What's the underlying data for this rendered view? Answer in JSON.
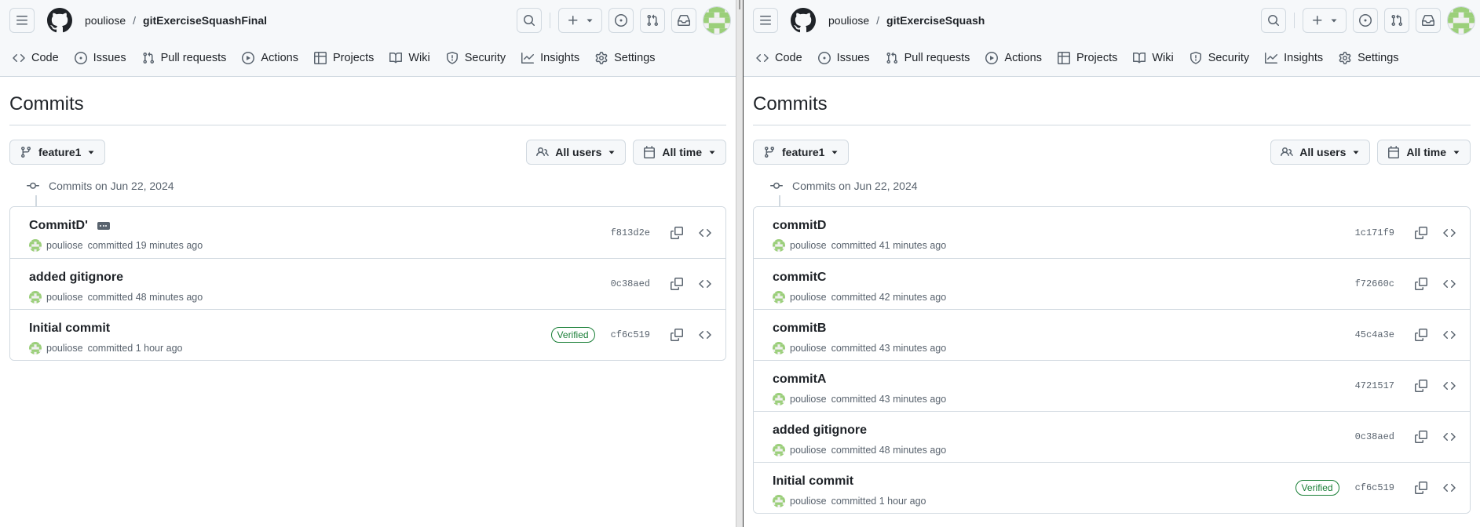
{
  "colors": {
    "accent_green": "#1a7f37",
    "muted": "#59636e",
    "border": "#d1d9e0",
    "header_bg": "#f6f8fa"
  },
  "panes": [
    {
      "owner": "pouliose",
      "separator": "/",
      "repo": "gitExerciseSquashFinal",
      "nav": [
        "Code",
        "Issues",
        "Pull requests",
        "Actions",
        "Projects",
        "Wiki",
        "Security",
        "Insights",
        "Settings"
      ],
      "page_title": "Commits",
      "branch": "feature1",
      "users_filter": "All users",
      "time_filter": "All time",
      "day_label": "Commits on Jun 22, 2024",
      "commits": [
        {
          "message": "CommitD'",
          "author": "pouliose",
          "meta": "committed 19 minutes ago",
          "sha": "f813d2e",
          "verified": "",
          "has_ellipsis": true
        },
        {
          "message": "added gitignore",
          "author": "pouliose",
          "meta": "committed 48 minutes ago",
          "sha": "0c38aed",
          "verified": "",
          "has_ellipsis": false
        },
        {
          "message": "Initial commit",
          "author": "pouliose",
          "meta": "committed 1 hour ago",
          "sha": "cf6c519",
          "verified": "Verified",
          "has_ellipsis": false
        }
      ]
    },
    {
      "owner": "pouliose",
      "separator": "/",
      "repo": "gitExerciseSquash",
      "nav": [
        "Code",
        "Issues",
        "Pull requests",
        "Actions",
        "Projects",
        "Wiki",
        "Security",
        "Insights",
        "Settings"
      ],
      "page_title": "Commits",
      "branch": "feature1",
      "users_filter": "All users",
      "time_filter": "All time",
      "day_label": "Commits on Jun 22, 2024",
      "commits": [
        {
          "message": "commitD",
          "author": "pouliose",
          "meta": "committed 41 minutes ago",
          "sha": "1c171f9",
          "verified": "",
          "has_ellipsis": false
        },
        {
          "message": "commitC",
          "author": "pouliose",
          "meta": "committed 42 minutes ago",
          "sha": "f72660c",
          "verified": "",
          "has_ellipsis": false
        },
        {
          "message": "commitB",
          "author": "pouliose",
          "meta": "committed 43 minutes ago",
          "sha": "45c4a3e",
          "verified": "",
          "has_ellipsis": false
        },
        {
          "message": "commitA",
          "author": "pouliose",
          "meta": "committed 43 minutes ago",
          "sha": "4721517",
          "verified": "",
          "has_ellipsis": false
        },
        {
          "message": "added gitignore",
          "author": "pouliose",
          "meta": "committed 48 minutes ago",
          "sha": "0c38aed",
          "verified": "",
          "has_ellipsis": false
        },
        {
          "message": "Initial commit",
          "author": "pouliose",
          "meta": "committed 1 hour ago",
          "sha": "cf6c519",
          "verified": "Verified",
          "has_ellipsis": false
        }
      ]
    }
  ]
}
